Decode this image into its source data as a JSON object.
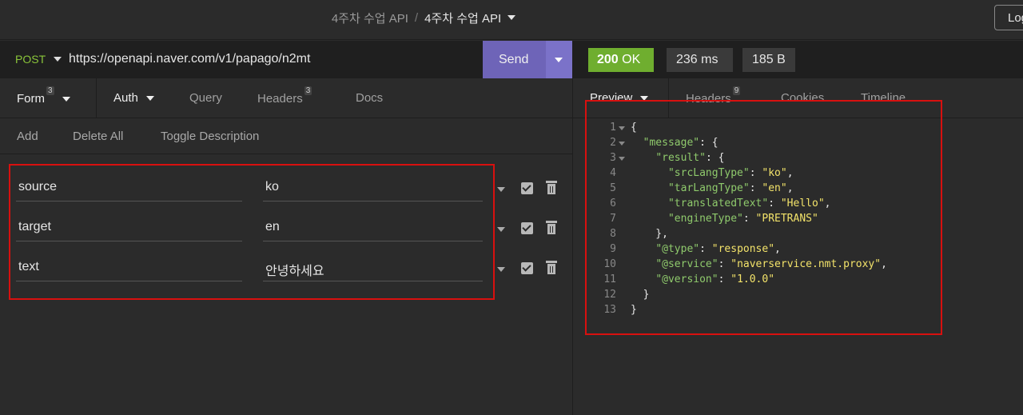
{
  "header": {
    "workspace": "4주차 수업 API",
    "separator": "/",
    "collection": "4주차 수업 API",
    "login_label": "Log"
  },
  "request": {
    "method": "POST",
    "url": "https://openapi.naver.com/v1/papago/n2mt",
    "send_label": "Send"
  },
  "request_tabs": {
    "form": "Form",
    "form_count": "3",
    "auth": "Auth",
    "query": "Query",
    "headers": "Headers",
    "headers_count": "3",
    "docs": "Docs"
  },
  "form_actions": {
    "add": "Add",
    "delete_all": "Delete All",
    "toggle_description": "Toggle Description"
  },
  "params": [
    {
      "key": "source",
      "value": "ko",
      "enabled": true
    },
    {
      "key": "target",
      "value": "en",
      "enabled": true
    },
    {
      "key": "text",
      "value": "안녕하세요",
      "enabled": true
    }
  ],
  "response": {
    "status": "200",
    "status_text": "OK",
    "time": "236 ms",
    "size": "185 B"
  },
  "response_tabs": {
    "preview": "Preview",
    "headers": "Headers",
    "headers_count": "9",
    "cookies": "Cookies",
    "timeline": "Timeline"
  },
  "colors": {
    "accent": "#6e64b8",
    "status_ok": "#6fae2f",
    "method": "#8ac53a",
    "highlight_box": "#d8100f"
  }
}
